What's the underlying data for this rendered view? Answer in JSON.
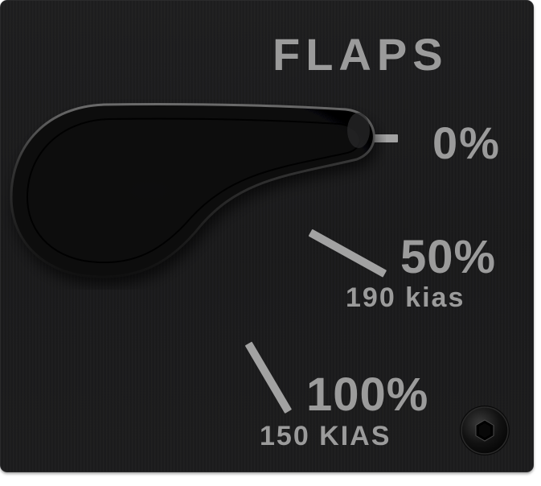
{
  "panel": {
    "title": "FLAPS",
    "positions": [
      {
        "label": "0%",
        "speed": ""
      },
      {
        "label": "50%",
        "speed": "190 kias"
      },
      {
        "label": "100%",
        "speed": "150 KIAS"
      }
    ],
    "selected_position": "0%"
  },
  "colors": {
    "panel_background": "#1c1c1d",
    "label": "#9b9b9b",
    "tick": "#a2a2a2"
  },
  "icons": {
    "lever": "flap-lever-handle-icon",
    "screw": "hex-screw-icon"
  }
}
